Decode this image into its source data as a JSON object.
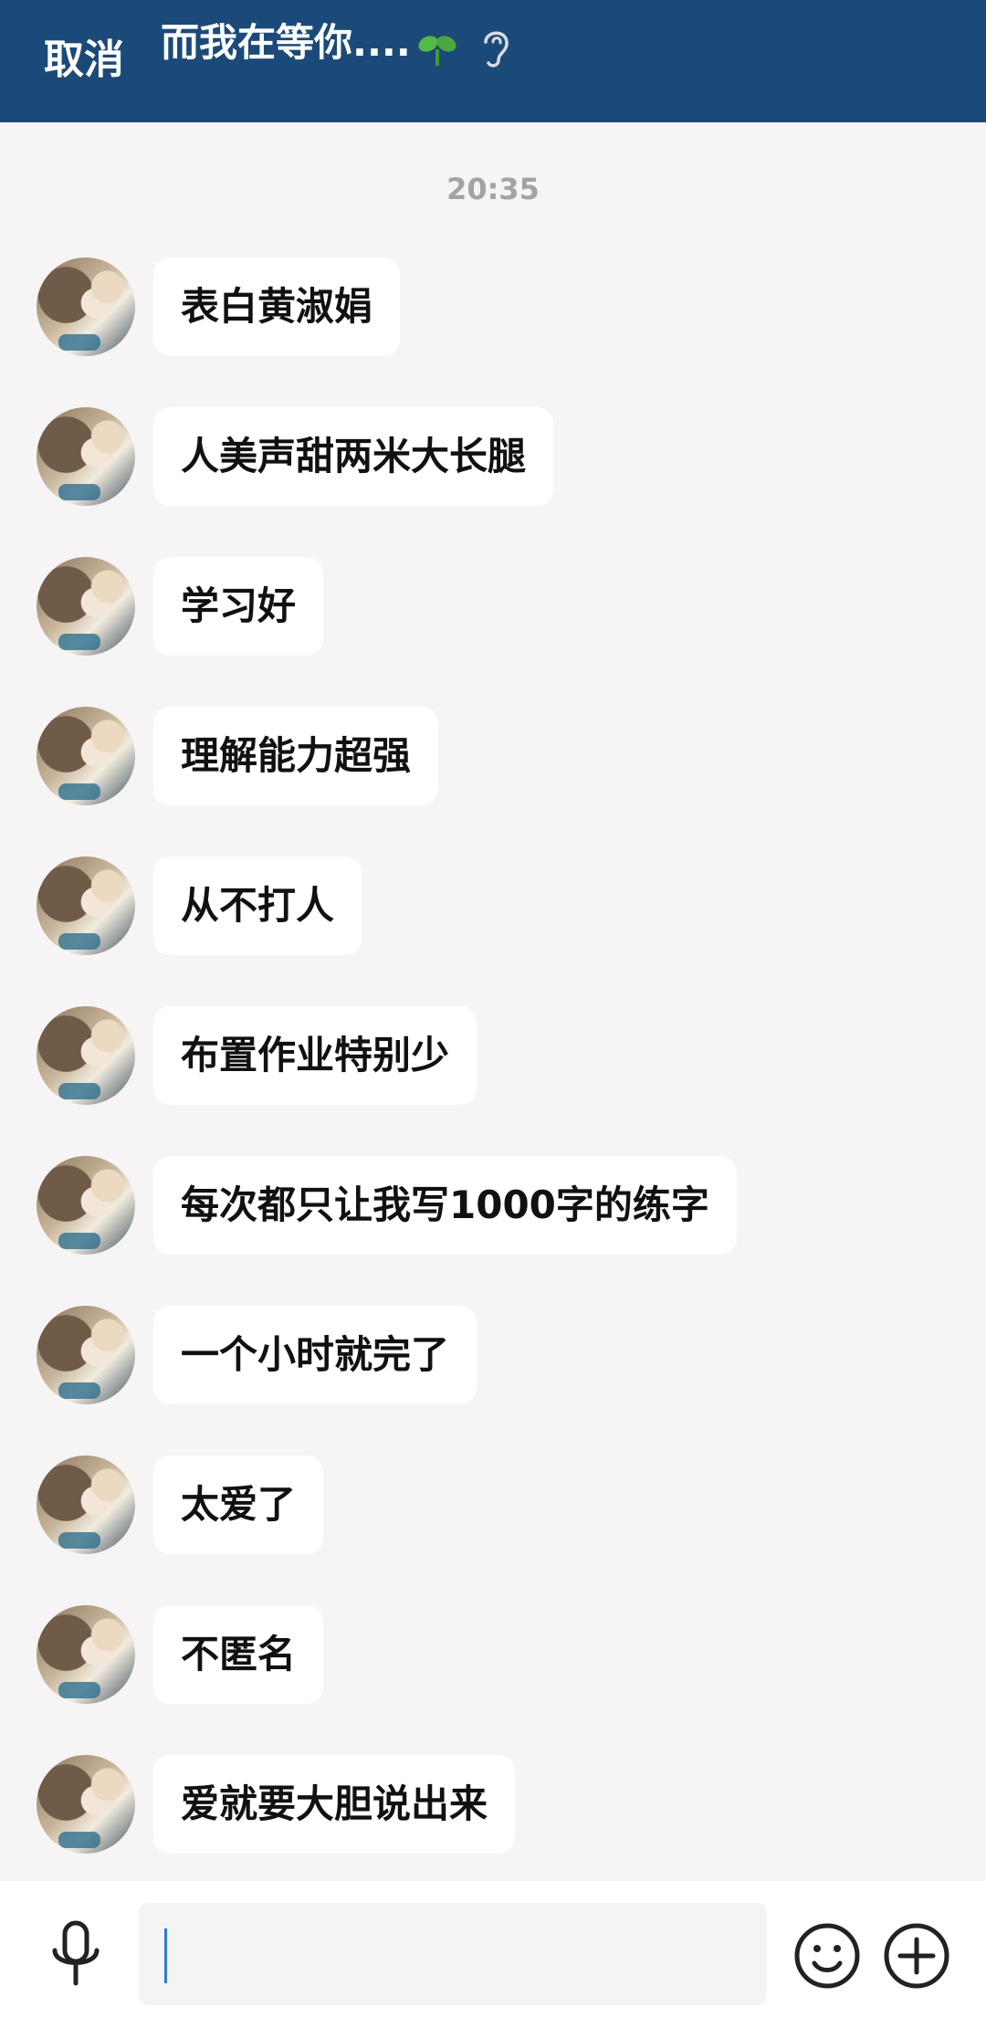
{
  "header": {
    "cancel_label": "取消",
    "title": "而我在等你....",
    "sprout_icon": "sprout-icon",
    "ear_icon": "ear-icon"
  },
  "chat": {
    "timestamp": "20:35",
    "messages": [
      {
        "text": "表白黄淑娟"
      },
      {
        "text": "人美声甜两米大长腿"
      },
      {
        "text": "学习好"
      },
      {
        "text": "理解能力超强"
      },
      {
        "text": "从不打人"
      },
      {
        "text": "布置作业特别少"
      },
      {
        "text": "每次都只让我写1000字的练字"
      },
      {
        "text": "一个小时就完了"
      },
      {
        "text": "太爱了"
      },
      {
        "text": "不匿名"
      },
      {
        "text": "爱就要大胆说出来"
      }
    ]
  },
  "input_bar": {
    "mic_icon": "microphone-icon",
    "input_value": "",
    "emoji_icon": "smiley-icon",
    "plus_icon": "plus-circle-icon"
  },
  "colors": {
    "header_bg": "#1c4a78",
    "page_bg": "#f6f4f5",
    "bubble_bg": "#ffffff",
    "caret": "#2b7bd6"
  }
}
